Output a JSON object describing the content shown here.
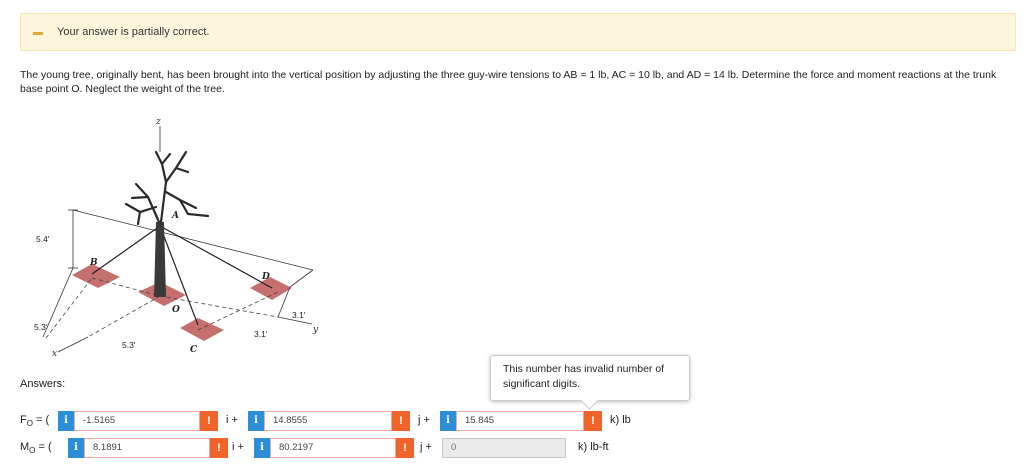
{
  "status": {
    "message": "Your answer is partially correct."
  },
  "problem": {
    "text": "The young tree, originally bent, has been brought into the vertical position by adjusting the three guy-wire tensions to AB = 1 lb, AC = 10 lb, and AD = 14 lb. Determine the force and moment reactions at the trunk base point O. Neglect the weight of the tree."
  },
  "figure": {
    "labels": {
      "z": "z",
      "a": "A",
      "b": "B",
      "c": "C",
      "d": "D",
      "o": "O",
      "x": "x",
      "y": "y",
      "dim_54": "5.4'",
      "dim_53_left": "5.3'",
      "dim_53_bottom": "5.3'",
      "dim_31_right": "3.1'",
      "dim_31_bottom": "3.1'"
    }
  },
  "answers": {
    "label": "Answers:",
    "force": {
      "label": "F",
      "subscript": "O",
      "suffix": " = (",
      "i_value": "-1.5165",
      "i_unit": "i +",
      "j_value": "14.8555",
      "j_unit": "j +",
      "k_value": "15.845",
      "k_unit": "k) lb"
    },
    "moment": {
      "label": "M",
      "subscript": "O",
      "suffix": " = (",
      "i_value": "8.1891",
      "i_unit": "i +",
      "j_value": "80.2197",
      "j_unit": "j +",
      "k_value": "0",
      "k_unit": "k) lb-ft"
    }
  },
  "tooltip": {
    "text": "This number has invalid number of significant digits."
  },
  "icons": {
    "info": "i",
    "error": "!"
  },
  "colors": {
    "info": "#2c8ed6",
    "error": "#f06429",
    "status_bg": "#fdf6dc"
  }
}
